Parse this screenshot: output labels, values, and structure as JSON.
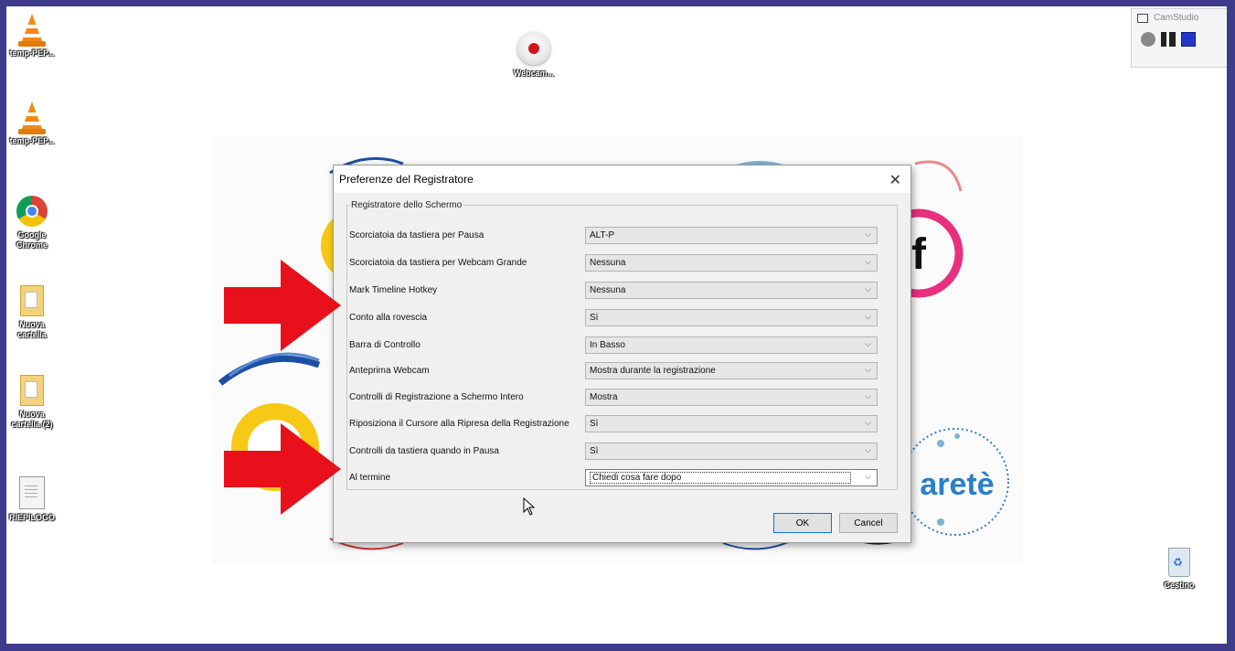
{
  "desktop": {
    "icons": [
      {
        "label": "temp-PEP..."
      },
      {
        "label": "temp-PEP..."
      },
      {
        "label": "Google Chrome"
      },
      {
        "label": "Nuova cartella"
      },
      {
        "label": "Nuova cartella (2)"
      },
      {
        "label": "RIEPILOGO"
      },
      {
        "label": "Webcam..."
      },
      {
        "label": "Cestino"
      }
    ]
  },
  "camstudio": {
    "title": "CamStudio"
  },
  "dialog": {
    "title": "Preferenze del Registratore",
    "group_label": "Registratore dello Schermo",
    "rows": [
      {
        "label": "Scorciatoia da tastiera per Pausa",
        "value": "ALT-P"
      },
      {
        "label": "Scorciatoia da tastiera per Webcam Grande",
        "value": "Nessuna"
      },
      {
        "label": "Mark Timeline Hotkey",
        "value": "Nessuna"
      },
      {
        "label": "Conto alla rovescia",
        "value": "Sì"
      },
      {
        "label": "Barra di Controllo",
        "value": "In Basso"
      },
      {
        "label": "Anteprima Webcam",
        "value": "Mostra durante la registrazione"
      },
      {
        "label": "Controlli di Registrazione a Schermo Intero",
        "value": "Mostra"
      },
      {
        "label": "Riposiziona il Cursore alla Ripresa della Registrazione",
        "value": "Sì"
      },
      {
        "label": "Controlli da tastiera quando in Pausa",
        "value": "Sì"
      },
      {
        "label": "Al termine",
        "value": "Chiedi cosa fare dopo"
      }
    ],
    "ok_label": "OK",
    "cancel_label": "Cancel"
  },
  "wallpaper": {
    "letter_f": "f",
    "arete_text": "aretè"
  },
  "colors": {
    "arrow": "#e8101a",
    "frame": "#3f3a8c"
  }
}
